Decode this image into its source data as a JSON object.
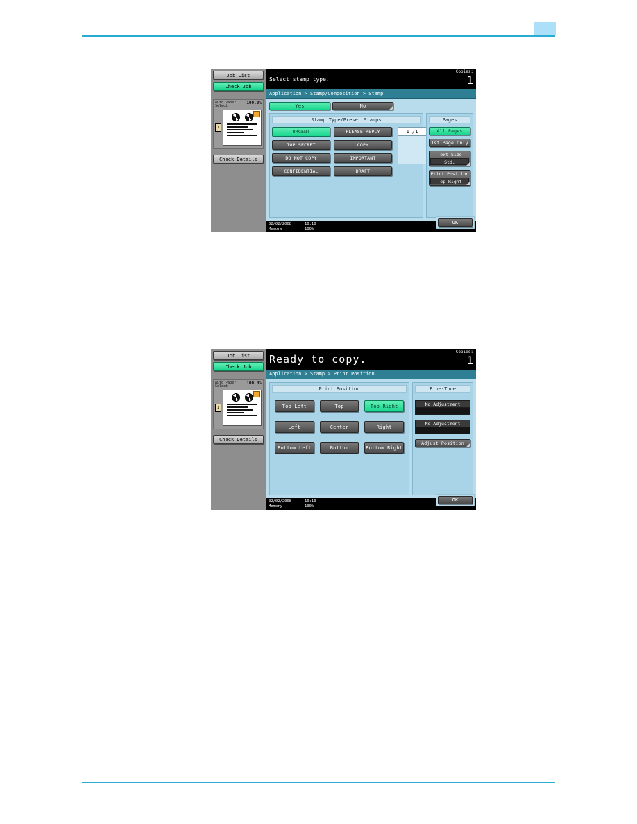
{
  "page": {
    "header_tab": "",
    "rules": "teal"
  },
  "colors": {
    "rule": "#29abd4",
    "header_tab": "#ace0f9",
    "selected_green": "#18d68e",
    "panel_bg": "#b9dced",
    "breadcrumb": "#2e7f94"
  },
  "panels": [
    {
      "id": "stamp",
      "message": "Select stamp type.",
      "copies_caption": "Copies:",
      "copies_value": "1",
      "breadcrumb": "Application > Stamp/Composition > Stamp",
      "sidebar": {
        "job_list": "Job List",
        "check_job": "Check Job",
        "paper_label": "Auto Paper Select",
        "zoom_value": "100.0%",
        "tray_number": "1",
        "check_details": "Check Details"
      },
      "toggle": [
        {
          "label": "Yes",
          "selected": true
        },
        {
          "label": "No",
          "selected": false
        }
      ],
      "stamp_section_title": "Stamp Type/Preset Stamps",
      "stamp_buttons": [
        {
          "label": "URGENT",
          "selected": true
        },
        {
          "label": "PLEASE REPLY",
          "selected": false
        },
        {
          "label": "TOP SECRET",
          "selected": false
        },
        {
          "label": "COPY",
          "selected": false
        },
        {
          "label": "DO NOT COPY",
          "selected": false
        },
        {
          "label": "IMPORTANT",
          "selected": false
        },
        {
          "label": "CONFIDENTIAL",
          "selected": false
        },
        {
          "label": "DRAFT",
          "selected": false
        }
      ],
      "counter": {
        "current": "1",
        "total": "/1"
      },
      "pages_section_title": "Pages",
      "pages_buttons": [
        {
          "label": "All Pages",
          "selected": true
        },
        {
          "label": "1st Page Only",
          "selected": false
        }
      ],
      "stacked_buttons": [
        {
          "caption": "Text Size",
          "value": "Std."
        },
        {
          "caption": "Print Position",
          "value": "Top Right"
        }
      ],
      "status": {
        "date": "02/02/2008",
        "time": "10:10",
        "memory_label": "Memory",
        "memory_value": "100%"
      },
      "ok_label": "OK"
    },
    {
      "id": "position",
      "message": "Ready to copy.",
      "copies_caption": "Copies:",
      "copies_value": "1",
      "breadcrumb": "Application > Stamp > Print Position",
      "sidebar": {
        "job_list": "Job List",
        "check_job": "Check Job",
        "paper_label": "Auto Paper Select",
        "zoom_value": "100.0%",
        "tray_number": "1",
        "check_details": "Check Details"
      },
      "position_section_title": "Print Position",
      "position_buttons": [
        {
          "label": "Top Left",
          "selected": false
        },
        {
          "label": "Top",
          "selected": false
        },
        {
          "label": "Top Right",
          "selected": true
        },
        {
          "label": "Left",
          "selected": false
        },
        {
          "label": "Center",
          "selected": false
        },
        {
          "label": "Right",
          "selected": false
        },
        {
          "label": "Bottom Left",
          "selected": false
        },
        {
          "label": "Bottom",
          "selected": false
        },
        {
          "label": "Bottom Right",
          "selected": false
        }
      ],
      "finetune_section_title": "Fine-Tune",
      "finetune_groups": [
        {
          "head": "No Adjustment",
          "value": ""
        },
        {
          "head": "No Adjustment",
          "value": ""
        }
      ],
      "adjust_position_label": "Adjust Position",
      "status": {
        "date": "02/02/2008",
        "time": "10:10",
        "memory_label": "Memory",
        "memory_value": "100%"
      },
      "ok_label": "OK"
    }
  ]
}
